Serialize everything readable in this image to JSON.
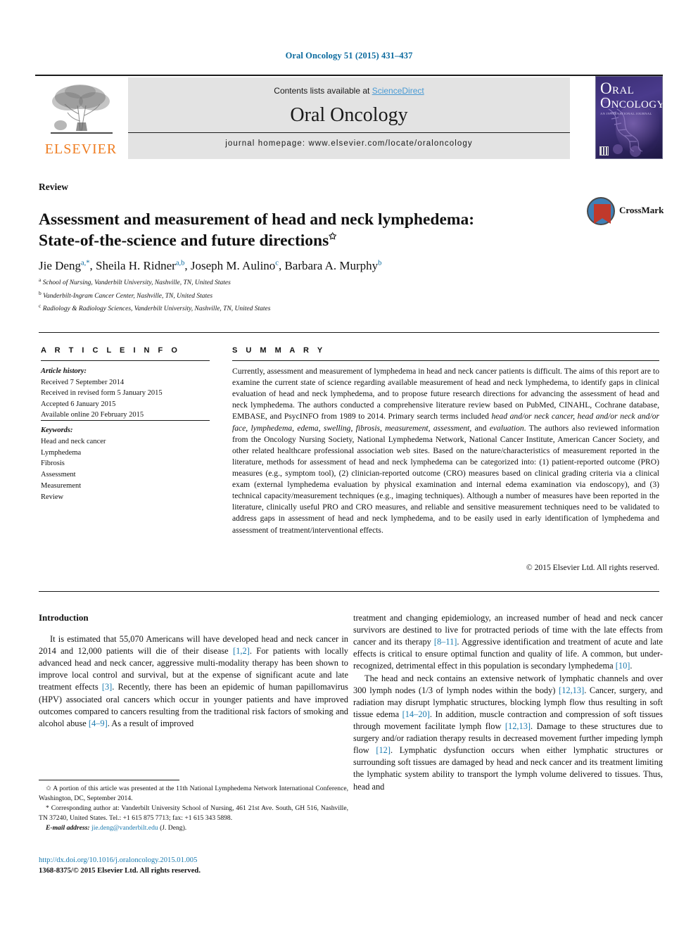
{
  "running_head": "Oral Oncology 51 (2015) 431–437",
  "masthead": {
    "contents_prefix": "Contents lists available at ",
    "sciencedirect": "ScienceDirect",
    "journal_name": "Oral Oncology",
    "homepage": "journal homepage: www.elsevier.com/locate/oraloncology",
    "publisher_logo_text": "ELSEVIER",
    "cover": {
      "line1": "RAL",
      "line2": "NCOLOGY",
      "big_o": "O",
      "subtitle": "AN INTERNATIONAL JOURNAL"
    }
  },
  "article": {
    "doctype": "Review",
    "title": "Assessment and measurement of head and neck lymphedema: State-of-the-science and future directions",
    "title_line1": "Assessment and measurement of head and neck lymphedema:",
    "title_line2": "State-of-the-science and future directions",
    "title_footnote_marker": "✩",
    "crossmark_label": "CrossMark",
    "authors": [
      {
        "name": "Jie Deng",
        "sup": "a,*"
      },
      {
        "name": "Sheila H. Ridner",
        "sup": "a,b"
      },
      {
        "name": "Joseph M. Aulino",
        "sup": "c"
      },
      {
        "name": "Barbara A. Murphy",
        "sup": "b"
      }
    ],
    "affiliations": [
      {
        "marker": "a",
        "text": "School of Nursing, Vanderbilt University, Nashville, TN, United States"
      },
      {
        "marker": "b",
        "text": "Vanderbilt-Ingram Cancer Center, Nashville, TN, United States"
      },
      {
        "marker": "c",
        "text": "Radiology & Radiology Sciences, Vanderbilt University, Nashville, TN, United States"
      }
    ]
  },
  "article_info": {
    "heading": "A R T I C L E  I N F O",
    "history_label": "Article history:",
    "history": [
      "Received 7 September 2014",
      "Received in revised form 5 January 2015",
      "Accepted 6 January 2015",
      "Available online 20 February 2015"
    ],
    "keywords_label": "Keywords:",
    "keywords": [
      "Head and neck cancer",
      "Lymphedema",
      "Fibrosis",
      "Assessment",
      "Measurement",
      "Review"
    ]
  },
  "summary": {
    "heading": "S U M M A R Y",
    "paragraph_parts": [
      {
        "type": "text",
        "value": "Currently, assessment and measurement of lymphedema in head and neck cancer patients is difficult. The aims of this report are to examine the current state of science regarding available measurement of head and neck lymphedema, to identify gaps in clinical evaluation of head and neck lymphedema, and to propose future research directions for advancing the assessment of head and neck lymphedema. The authors conducted a comprehensive literature review based on PubMed, CINAHL, Cochrane database, EMBASE, and PsycINFO from 1989 to 2014. Primary search terms included "
      },
      {
        "type": "italic",
        "value": "head and/or neck cancer, head and/or neck and/or face, lymphedema, edema, swelling, fibrosis, measurement, assessment,"
      },
      {
        "type": "text",
        "value": " and "
      },
      {
        "type": "italic",
        "value": "evaluation"
      },
      {
        "type": "text",
        "value": ". The authors also reviewed information from the Oncology Nursing Society, National Lymphedema Network, National Cancer Institute, American Cancer Society, and other related healthcare professional association web sites. Based on the nature/characteristics of measurement reported in the literature, methods for assessment of head and neck lymphedema can be categorized into: (1) patient-reported outcome (PRO) measures (e.g., symptom tool), (2) clinician-reported outcome (CRO) measures based on clinical grading criteria via a clinical exam (external lymphedema evaluation by physical examination and internal edema examination via endoscopy), and (3) technical capacity/measurement techniques (e.g., imaging techniques). Although a number of measures have been reported in the literature, clinically useful PRO and CRO measures, and reliable and sensitive measurement techniques need to be validated to address gaps in assessment of head and neck lymphedema, and to be easily used in early identification of lymphedema and assessment of treatment/interventional effects."
      }
    ],
    "copyright": "© 2015 Elsevier Ltd. All rights reserved."
  },
  "body": {
    "section_title": "Introduction",
    "left_paragraphs": [
      "It is estimated that 55,070 Americans will have developed head and neck cancer in 2014 and 12,000 patients will die of their disease [1,2]. For patients with locally advanced head and neck cancer, aggressive multi-modality therapy has been shown to improve local control and survival, but at the expense of significant acute and late treatment effects [3]. Recently, there has been an epidemic of human papillomavirus (HPV) associated oral cancers which occur in younger patients and have improved outcomes compared to cancers resulting from the traditional risk factors of smoking and alcohol abuse [4–9]. As a result of improved"
    ],
    "right_paragraphs": [
      "treatment and changing epidemiology, an increased number of head and neck cancer survivors are destined to live for protracted periods of time with the late effects from cancer and its therapy [8–11]. Aggressive identification and treatment of acute and late effects is critical to ensure optimal function and quality of life. A common, but under-recognized, detrimental effect in this population is secondary lymphedema [10].",
      "The head and neck contains an extensive network of lymphatic channels and over 300 lymph nodes (1/3 of lymph nodes within the body) [12,13]. Cancer, surgery, and radiation may disrupt lymphatic structures, blocking lymph flow thus resulting in soft tissue edema [14–20]. In addition, muscle contraction and compression of soft tissues through movement facilitate lymph flow [12,13]. Damage to these structures due to surgery and/or radiation therapy results in decreased movement further impeding lymph flow [12]. Lymphatic dysfunction occurs when either lymphatic structures or surrounding soft tissues are damaged by head and neck cancer and its treatment limiting the lymphatic system ability to transport the lymph volume delivered to tissues. Thus, head and"
    ]
  },
  "footnotes": {
    "star_note": "✩ A portion of this article was presented at the 11th National Lymphedema Network International Conference, Washington, DC, September 2014.",
    "corresponding": "* Corresponding author at: Vanderbilt University School of Nursing, 461 21st Ave. South, GH 516, Nashville, TN 37240, United States. Tel.: +1 615 875 7713; fax: +1 615 343 5898.",
    "email_label": "E-mail address:",
    "email": "jie.deng@vanderbilt.edu",
    "email_suffix": "(J. Deng).",
    "doi": "http://dx.doi.org/10.1016/j.oraloncology.2015.01.005",
    "issn_line": "1368-8375/© 2015 Elsevier Ltd. All rights reserved."
  },
  "colors": {
    "link_blue": "#1a7aaf",
    "sciencedirect_blue": "#4a9bd4",
    "elsevier_orange": "#ef7d22",
    "running_head_blue": "#0b6a9e"
  }
}
